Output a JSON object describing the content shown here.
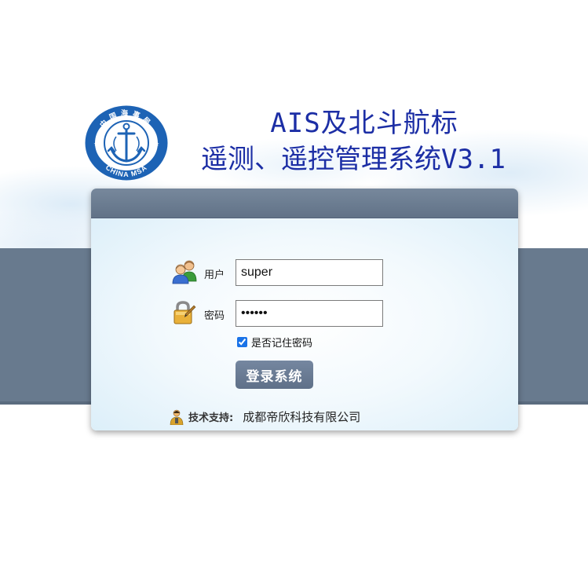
{
  "header": {
    "logo_ring_text": "中国海事局",
    "logo_bottom_text": "CHINA MSA",
    "title_line1": "AIS及北斗航标",
    "title_line2": "遥测、遥控管理系统V3.1"
  },
  "login": {
    "username_label": "用户",
    "username_value": "super",
    "password_label": "密码",
    "password_value": "superx",
    "remember_label": "是否记住密码",
    "remember_checked": true,
    "submit_label": "登录系统"
  },
  "footer": {
    "support_label": "技术支持:",
    "company": "成都帝欣科技有限公司"
  },
  "colors": {
    "band": "#687a8e",
    "title": "#1c2ea5",
    "button": "#687a8e",
    "logo_blue": "#1d63b5"
  },
  "icons": {
    "logo": "anchor-emblem-icon",
    "user": "users-icon",
    "password": "padlock-icon",
    "support": "support-person-icon"
  }
}
